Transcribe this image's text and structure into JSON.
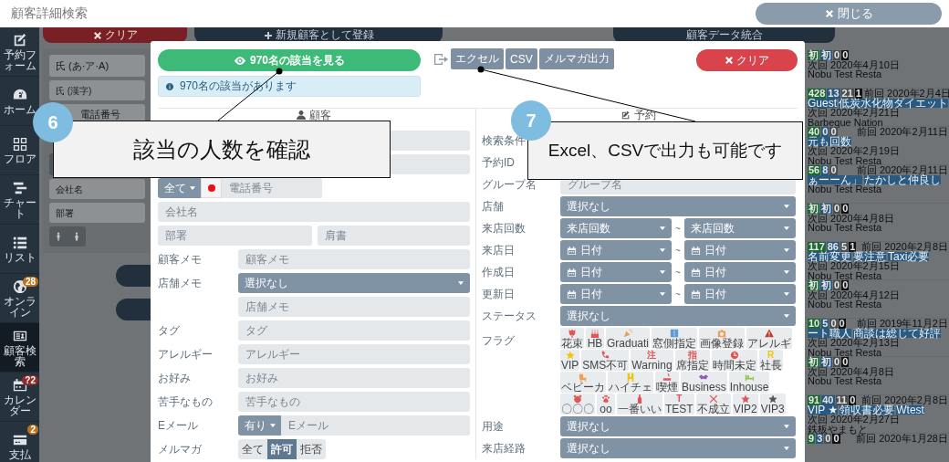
{
  "header": {
    "title": "顧客詳細検索",
    "close_button": "閉じる"
  },
  "sidebar": {
    "items": [
      {
        "label": "予約フォーム",
        "selected": false
      },
      {
        "label": "ホーム",
        "selected": false
      },
      {
        "label": "フロア",
        "selected": false
      },
      {
        "label": "チャート",
        "selected": false
      },
      {
        "label": "リスト",
        "selected": false
      },
      {
        "label": "オンライン",
        "selected": false,
        "badge": "28",
        "color": "#b8751f"
      },
      {
        "label": "顧客検索",
        "selected": true
      },
      {
        "label": "カレンダー",
        "selected": false,
        "badge": "?2",
        "color": "#8e2a2a"
      },
      {
        "label": "支払",
        "selected": false,
        "badge": "2",
        "color": "#b8751f"
      }
    ]
  },
  "toolbar": [
    {
      "label": "クリア",
      "kind": "danger"
    },
    {
      "label": "新規顧客として登録",
      "kind": "add"
    },
    {
      "label": "顧客データ統合",
      "kind": "plain"
    }
  ],
  "filter_panel": {
    "fields": [
      {
        "kind": "input",
        "placeholder": "氏 (あ·ア·A)"
      },
      {
        "kind": "input",
        "placeholder": "氏 (漢字)"
      },
      {
        "kind": "phone",
        "placeholder": "電話番号"
      },
      {
        "kind": "select"
      },
      {
        "kind": "input",
        "placeholder": "会社名"
      },
      {
        "kind": "input",
        "placeholder": "部署"
      },
      {
        "kind": "gender"
      }
    ]
  },
  "customer_list": [
    {
      "counts": [
        "初",
        "初",
        "0",
        "0"
      ],
      "next": "次回 2020年4月10日",
      "shop": "Nobu Test Resta"
    },
    {
      "counts": [
        "428",
        "13",
        "21",
        "1"
      ],
      "previous": "前回 2020年2月4日",
      "tags": [
        "Guest",
        "低炭水化物ダイエット"
      ],
      "next": "次回 2020年2月21日",
      "shop": "Barbeque Nation"
    },
    {
      "counts": [
        "40",
        "0",
        "0"
      ],
      "previous": "前回 2020年2月11日",
      "tags": [
        "元も回数"
      ],
      "next": "次回 2020年2月19日",
      "shop": "Nobu Test Resta"
    },
    {
      "counts": [
        "56",
        "8",
        "0"
      ],
      "previous": "前回 2020年2月11日",
      "tags": [
        "ぁーーん」",
        "たかしと仲良し"
      ],
      "shop": "Nobu Test Resta"
    },
    {
      "counts": [
        "初",
        "初",
        "0",
        "0"
      ],
      "next": "次回 2020年4月8日",
      "shop": "Nobu Test Resta"
    },
    {
      "counts": [
        "117",
        "86",
        "5",
        "1"
      ],
      "previous": "前回 2020年2月8日",
      "tags": [
        "名前変更",
        "要注意",
        "Taxi必要"
      ],
      "next": "次回 2020年2月15日",
      "shop": "Nobu Test Resta"
    },
    {
      "counts": [
        "初",
        "初",
        "0",
        "0"
      ],
      "next": "次回 2020年4月12日",
      "shop": "Nobu Test Resta"
    },
    {
      "counts": [
        "10",
        "5",
        "0",
        "0"
      ],
      "previous": "前回 2019年11月2日",
      "tags": [
        "ート職人",
        "商談は総じて好評"
      ],
      "next": "次回 2020年2月13日",
      "shop": "Nobu Test Resta"
    },
    {
      "counts": [
        "初",
        "初",
        "0",
        "0"
      ],
      "next": "次回 2020年4月8日",
      "shop": "Nobu Test Resta"
    },
    {
      "counts": [
        "91",
        "40",
        "11",
        "0"
      ],
      "previous": "前回 2020年2月8日",
      "tags": [
        "VIP ★",
        "領収書必要",
        "Wtest"
      ],
      "next": "次回 2020年2月27日",
      "shop": "鉄板やまもと"
    },
    {
      "counts": [
        "9",
        "3",
        "0",
        "0"
      ],
      "previous": "前回 2020年1月28日"
    }
  ],
  "search": {
    "view_button": "970名の該当を見る",
    "export_buttons": [
      "エクセル",
      "CSV",
      "メルマガ出力"
    ],
    "clear_button": "クリア",
    "result_info": "970名の該当があります"
  },
  "customer": {
    "heading": "顧客",
    "rows": [
      {
        "kind": "input"
      },
      {
        "kind": "input"
      },
      {
        "kind": "phone",
        "select": "全て",
        "placeholder": "電話番号"
      },
      {
        "kind": "input",
        "placeholder": "会社名"
      },
      {
        "kind": "pair",
        "placeholders": [
          "部署",
          "肩書"
        ]
      },
      {
        "kind": "input",
        "label": "顧客メモ",
        "placeholder": "顧客メモ"
      },
      {
        "kind": "select",
        "label": "店舗メモ",
        "value": "選択なし"
      },
      {
        "kind": "input",
        "placeholder": "店舗メモ",
        "indented": true
      },
      {
        "kind": "input",
        "label": "タグ",
        "placeholder": "タグ"
      },
      {
        "kind": "input",
        "label": "アレルギー",
        "placeholder": "アレルギー"
      },
      {
        "kind": "input",
        "label": "お好み",
        "placeholder": "お好み"
      },
      {
        "kind": "input",
        "label": "苦手なもの",
        "placeholder": "苦手なもの"
      },
      {
        "kind": "select_input",
        "label": "Eメール",
        "select": "有り",
        "placeholder": "Eメール"
      },
      {
        "kind": "segmented",
        "label": "メルマガ",
        "options": [
          {
            "label": "全て",
            "selected": false
          },
          {
            "label": "許可",
            "selected": true
          },
          {
            "label": "拒否",
            "selected": false
          }
        ]
      }
    ]
  },
  "reservation": {
    "heading": "予約",
    "rows": [
      {
        "kind": "label",
        "label": "検索条件"
      },
      {
        "kind": "label",
        "label": "予約ID"
      },
      {
        "kind": "input",
        "label": "グループ名",
        "placeholder": "グループ名"
      },
      {
        "kind": "select",
        "label": "店舗",
        "value": "選択なし"
      },
      {
        "kind": "range",
        "label": "来店回数",
        "from": "来店回数",
        "to": "来店回数",
        "separator": "~"
      },
      {
        "kind": "date_range",
        "label": "来店日",
        "from": "日付",
        "to": "日付",
        "separator": "~"
      },
      {
        "kind": "date_range",
        "label": "作成日",
        "from": "日付",
        "to": "日付",
        "separator": "~"
      },
      {
        "kind": "date_range",
        "label": "更新日",
        "from": "日付",
        "to": "日付",
        "separator": "~"
      },
      {
        "kind": "select",
        "label": "ステータス",
        "value": "選択なし"
      },
      {
        "kind": "flags",
        "label": "フラグ",
        "flags": [
          {
            "label": "花束",
            "color": "#e05555"
          },
          {
            "label": "HB",
            "color": "#e05555"
          },
          {
            "label": "Graduati",
            "color": "#e8a060"
          },
          {
            "label": "窓側指定",
            "color": "#5b9bd5"
          },
          {
            "label": "画像登録",
            "color": "#f0a050"
          },
          {
            "label": "アレルギ",
            "color": "#c0392b"
          },
          {
            "label": "VIP",
            "color": "#f1c40f"
          },
          {
            "label": "SMS不可",
            "color": "#e05555"
          },
          {
            "label": "Warning",
            "color": "#e05555",
            "glyph": "注"
          },
          {
            "label": "席指定",
            "color": "#e05555",
            "glyph": "指"
          },
          {
            "label": "時間未定",
            "color": "#e05555"
          },
          {
            "label": "社長",
            "color": "#f1c40f",
            "glyph": "R"
          },
          {
            "label": "ベビーカ",
            "color": "#f0a050"
          },
          {
            "label": "ハイチェ",
            "color": "#f1c40f"
          },
          {
            "label": "喫煙",
            "color": "#e05555"
          },
          {
            "label": "Business",
            "color": "#9b59b6"
          },
          {
            "label": "Inhouse",
            "color": "#8bc34a"
          },
          {
            "label": "〇〇〇",
            "color": "#e05555"
          },
          {
            "label": "oo",
            "color": "#e05555"
          },
          {
            "label": "一番いい",
            "color": "#e05555"
          },
          {
            "label": "TEST",
            "color": "#e05555",
            "glyph": "T"
          },
          {
            "label": "不成立",
            "color": "#e05555"
          },
          {
            "label": "VIP2",
            "color": "#e05555"
          },
          {
            "label": "VIP3",
            "color": "#555555"
          }
        ]
      },
      {
        "kind": "select",
        "label": "用途",
        "value": "選択なし"
      },
      {
        "kind": "select",
        "label": "来店経路",
        "value": "選択なし"
      }
    ]
  },
  "callouts": [
    {
      "number": "6",
      "text": "該当の人数を確認"
    },
    {
      "number": "7",
      "text": "Excel、CSVで出力も可能です"
    }
  ]
}
